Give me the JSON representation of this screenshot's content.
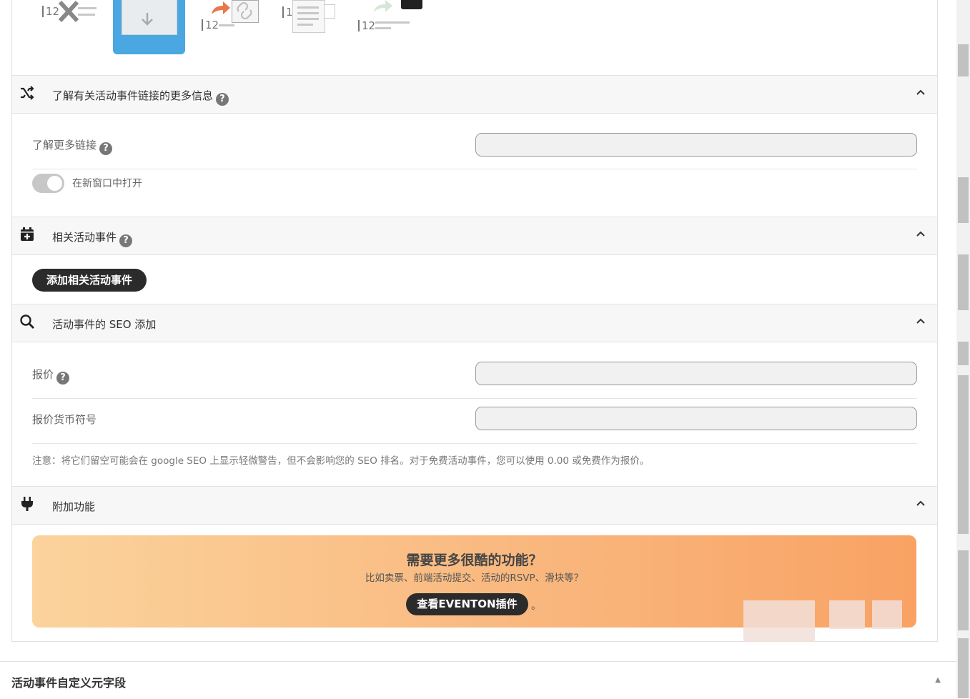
{
  "layouts": {
    "selected_index": 1,
    "number_label": "12"
  },
  "sections": {
    "learn_more": {
      "title": "了解有关活动事件链接的更多信息",
      "icon": "shuffle-icon",
      "field_label": "了解更多链接",
      "field_value": "",
      "toggle_label": "在新窗口中打开",
      "toggle_on": false
    },
    "related": {
      "title": "相关活动事件",
      "icon": "calendar-plus-icon",
      "button_label": "添加相关活动事件"
    },
    "seo": {
      "title": "活动事件的 SEO 添加",
      "icon": "search-icon",
      "price_label": "报价",
      "price_value": "",
      "currency_label": "报价货币符号",
      "currency_value": "",
      "note": "注意：将它们留空可能会在 google SEO 上显示轻微警告，但不会影响您的 SEO 排名。对于免费活动事件，您可以使用 0.00 或免费作为报价。"
    },
    "addons": {
      "title": "附加功能",
      "icon": "plug-icon",
      "promo_title": "需要更多很酷的功能？",
      "promo_subtitle": "比如卖票、前端活动提交、活动的RSVP、滑块等？",
      "promo_button": "查看EVENTON插件",
      "promo_suffix": "。"
    }
  },
  "bottom": {
    "title": "活动事件自定义元字段"
  },
  "colors": {
    "accent_blue": "#4aa7e2",
    "dark_button": "#2b2b2b",
    "promo_start": "#fbd39c",
    "promo_end": "#f9a264"
  }
}
